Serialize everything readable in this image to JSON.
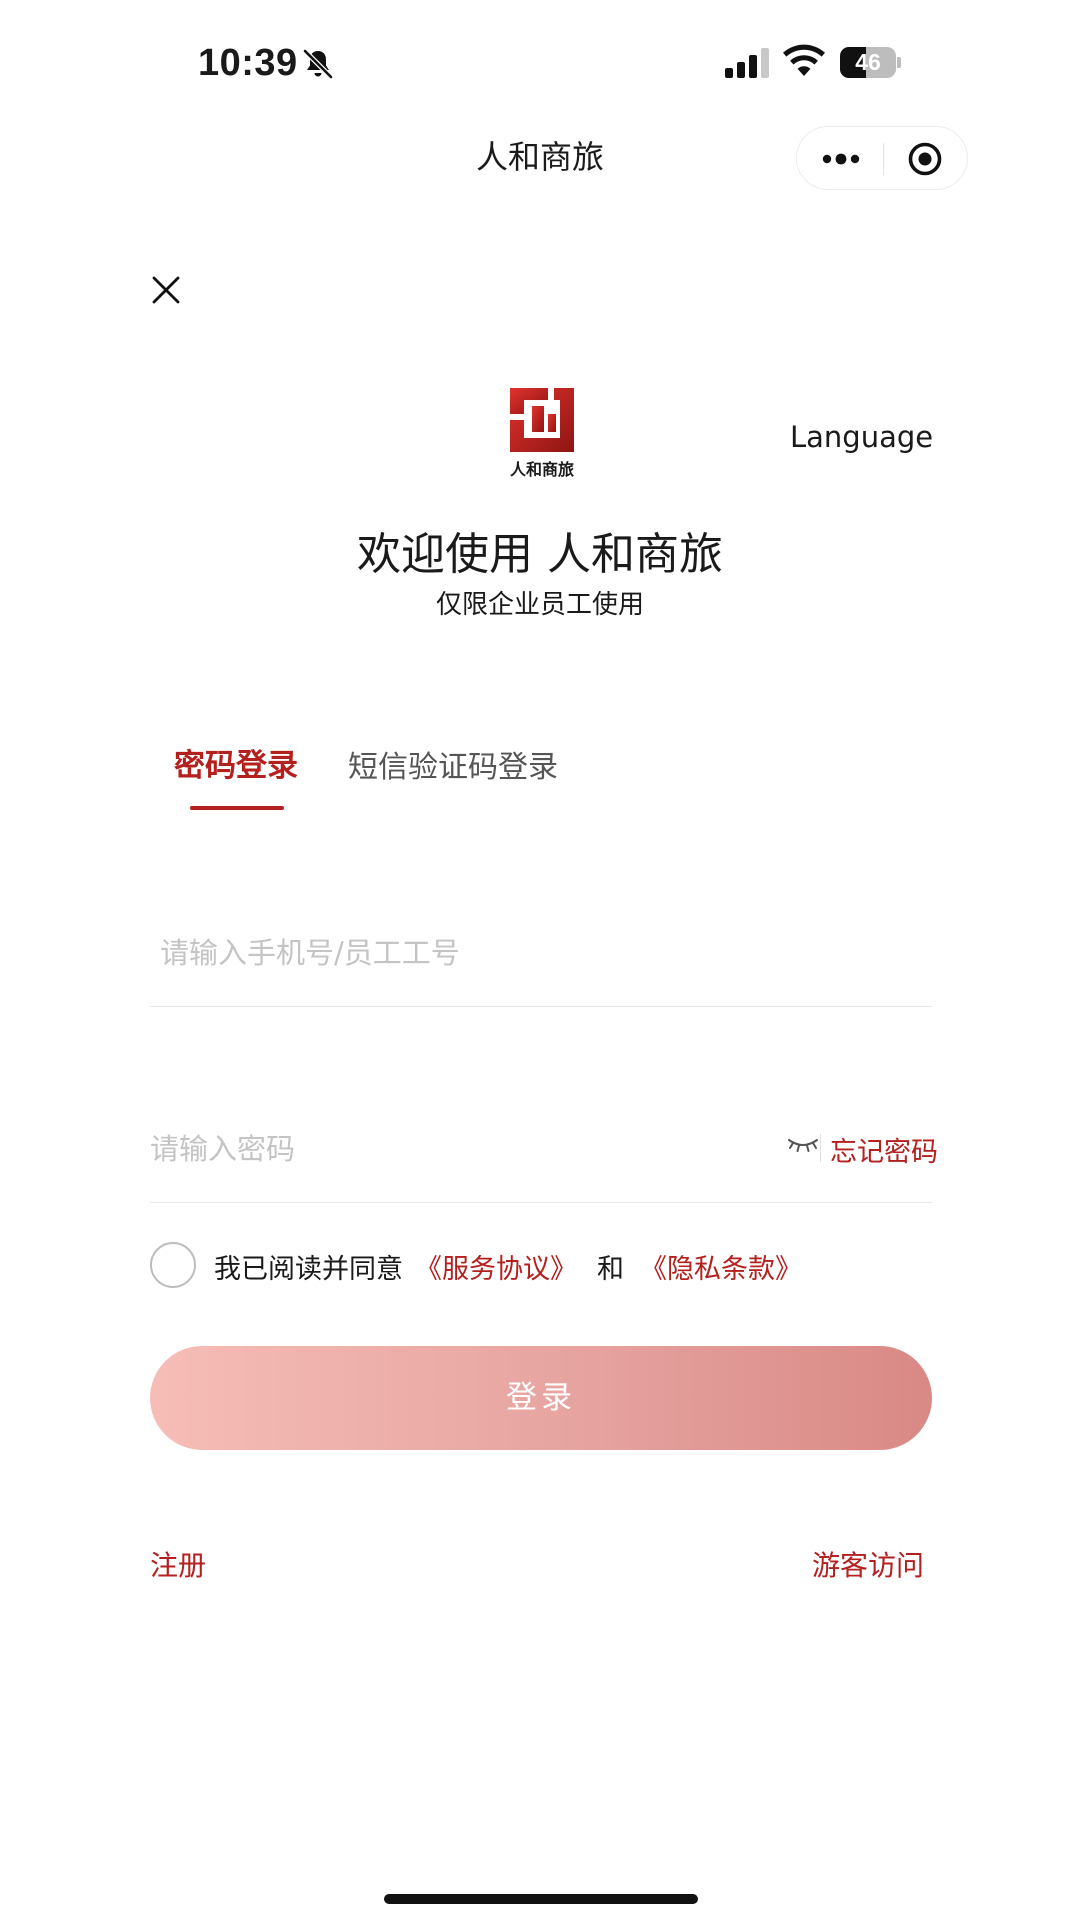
{
  "status_bar": {
    "time": "10:39",
    "battery_level": 46,
    "battery_label": "46",
    "icons": [
      "bell-slash-icon",
      "signal-icon",
      "wifi-icon",
      "battery-icon"
    ]
  },
  "nav": {
    "title": "人和商旅",
    "capsule_icons": [
      "more-icon",
      "close-miniprogram-icon"
    ]
  },
  "header": {
    "close_icon": "close-icon",
    "logo_text": "人和商旅",
    "language_label": "Language",
    "welcome": "欢迎使用 人和商旅",
    "subtitle": "仅限企业员工使用"
  },
  "tabs": [
    {
      "label": "密码登录",
      "active": true
    },
    {
      "label": "短信验证码登录",
      "active": false
    }
  ],
  "form": {
    "phone_placeholder": "请输入手机号/员工工号",
    "phone_value": "",
    "password_placeholder": "请输入密码",
    "password_value": "",
    "eye_icon": "eye-closed-icon",
    "forgot_label": "忘记密码"
  },
  "agreement": {
    "checked": false,
    "text": "我已阅读并同意",
    "service_link": "《服务协议》",
    "and": "和",
    "privacy_link": "《隐私条款》"
  },
  "login_button_label": "登录",
  "footer": {
    "register_label": "注册",
    "guest_label": "游客访问"
  },
  "colors": {
    "accent": "#b3201e",
    "button_gradient_start": "#f6bdb6",
    "button_gradient_end": "#d98985",
    "placeholder": "#c4c4c4",
    "divider": "#e8e8e8"
  }
}
